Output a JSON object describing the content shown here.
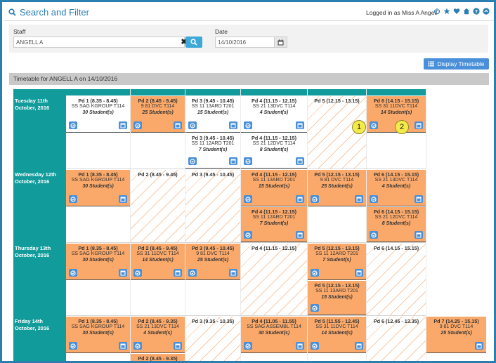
{
  "header": {
    "title": "Search and Filter",
    "logged_in": "Logged in as Miss A Angell",
    "icons": [
      "power-icon",
      "star-icon",
      "heart-icon",
      "home-icon",
      "help-icon",
      "chevron-up-icon"
    ]
  },
  "filter": {
    "staff_label": "Staff",
    "staff_value": "ANGELL A",
    "date_label": "Date",
    "date_value": "14/10/2016",
    "clear_symbol": "✖"
  },
  "display_button": "Display Timetable",
  "timetable_title": "Timetable for ANGELL A on 14/10/2016",
  "days": [
    {
      "label": "Tuesday 11th October, 2016"
    },
    {
      "label": "Wednesday 12th October, 2016"
    },
    {
      "label": "Thursday 13th October, 2016"
    },
    {
      "label": "Friday 14th October, 2016"
    }
  ],
  "lessons": [
    {
      "period": "Pd 1 (8.35 - 8.45)",
      "class": "SS SAG KGROUP T114",
      "students": "30 Student(s)"
    },
    {
      "period": "Pd 2 (8.45 - 9.45)",
      "class": "9 81 DVC T114",
      "students": "25 Student(s)"
    },
    {
      "period": "Pd 3 (9.45 - 10.45)",
      "class": "SS 11 13ARD T201",
      "students": "15 Student(s)"
    },
    {
      "period": "Pd 4 (11.15 - 12.15)",
      "class": "SS 21 13DVC T114",
      "students": "4 Student(s)"
    },
    {
      "period": "Pd 5 (12.15 - 13.15)"
    },
    {
      "period": "Pd 6 (14.15 - 15.15)",
      "class": "SS 31 11DVC T114",
      "students": "14 Student(s)"
    },
    {
      "period": "Pd 3 (9.45 - 10.45)",
      "class": "SS 11 12ARD T201",
      "students": "7 Student(s)"
    },
    {
      "period": "Pd 4 (11.15 - 12.15)",
      "class": "SS 21 12DVC T114",
      "students": "8 Student(s)"
    },
    {
      "period": "Pd 1 (8.35 - 8.45)",
      "class": "SS SAG KGROUP T114",
      "students": "30 Student(s)"
    },
    {
      "period": "Pd 2 (8.45 - 9.45)"
    },
    {
      "period": "Pd 3 (9.45 - 10.45)"
    },
    {
      "period": "Pd 4 (11.15 - 12.15)",
      "class": "SS 11 13ARD T201",
      "students": "15 Student(s)"
    },
    {
      "period": "Pd 5 (12.15 - 13.15)",
      "class": "9 81 DVC T114",
      "students": "25 Student(s)"
    },
    {
      "period": "Pd 6 (14.15 - 15.15)",
      "class": "SS 21 13DVC T114",
      "students": "4 Student(s)"
    },
    {
      "period": "Pd 4 (11.15 - 12.15)",
      "class": "SS 11 12ARD T201",
      "students": "7 Student(s)"
    },
    {
      "period": "Pd 6 (14.15 - 15.15)",
      "class": "SS 21 12DVC T114",
      "students": "8 Student(s)"
    },
    {
      "period": "Pd 1 (8.35 - 8.45)",
      "class": "SS SAG KGROUP T114",
      "students": "30 Student(s)"
    },
    {
      "period": "Pd 2 (8.45 - 9.45)",
      "class": "SS 31 11DVC T114",
      "students": "14 Student(s)"
    },
    {
      "period": "Pd 3 (9.45 - 10.45)",
      "class": "9 81 DVC T114",
      "students": "25 Student(s)"
    },
    {
      "period": "Pd 4 (11.15 - 12.15)"
    },
    {
      "period": "Pd 5 (12.15 - 13.15)",
      "class": "SS 11 12ARD T201",
      "students": "7 Student(s)"
    },
    {
      "period": "Pd 6 (14.15 - 15.15)"
    },
    {
      "period": "Pd 5 (12.15 - 13.15)",
      "class": "SS 11 13ARD T201",
      "students": "15 Student(s)"
    },
    {
      "period": "Pd 1 (8.35 - 8.45)",
      "class": "SS SAG KGROUP T114",
      "students": "30 Student(s)"
    },
    {
      "period": "Pd 2 (8.45 - 9.35)",
      "class": "SS 21 13DVC T114",
      "students": "4 Student(s)"
    },
    {
      "period": "Pd 3 (9.35 - 10.35)"
    },
    {
      "period": "Pd 4 (11.05 - 11.55)",
      "class": "SS SAG ASSEMBL T114",
      "students": "30 Student(s)"
    },
    {
      "period": "Pd 5 (11.55 - 12.45)",
      "class": "SS 31 11DVC T114",
      "students": "14 Student(s)"
    },
    {
      "period": "Pd 6 (12.45 - 13.35)"
    },
    {
      "period": "Pd 7 (14.25 - 15.15)",
      "class": "9 81 DVC T114",
      "students": "25 Student(s)"
    },
    {
      "period": "Pd 2 (8.45 - 9.35)"
    }
  ],
  "markers": [
    "1",
    "2"
  ],
  "colors": {
    "teal": "#129b9b",
    "orange": "#fba96a",
    "blue": "#4a90d9",
    "accent": "#2b7fb0"
  }
}
